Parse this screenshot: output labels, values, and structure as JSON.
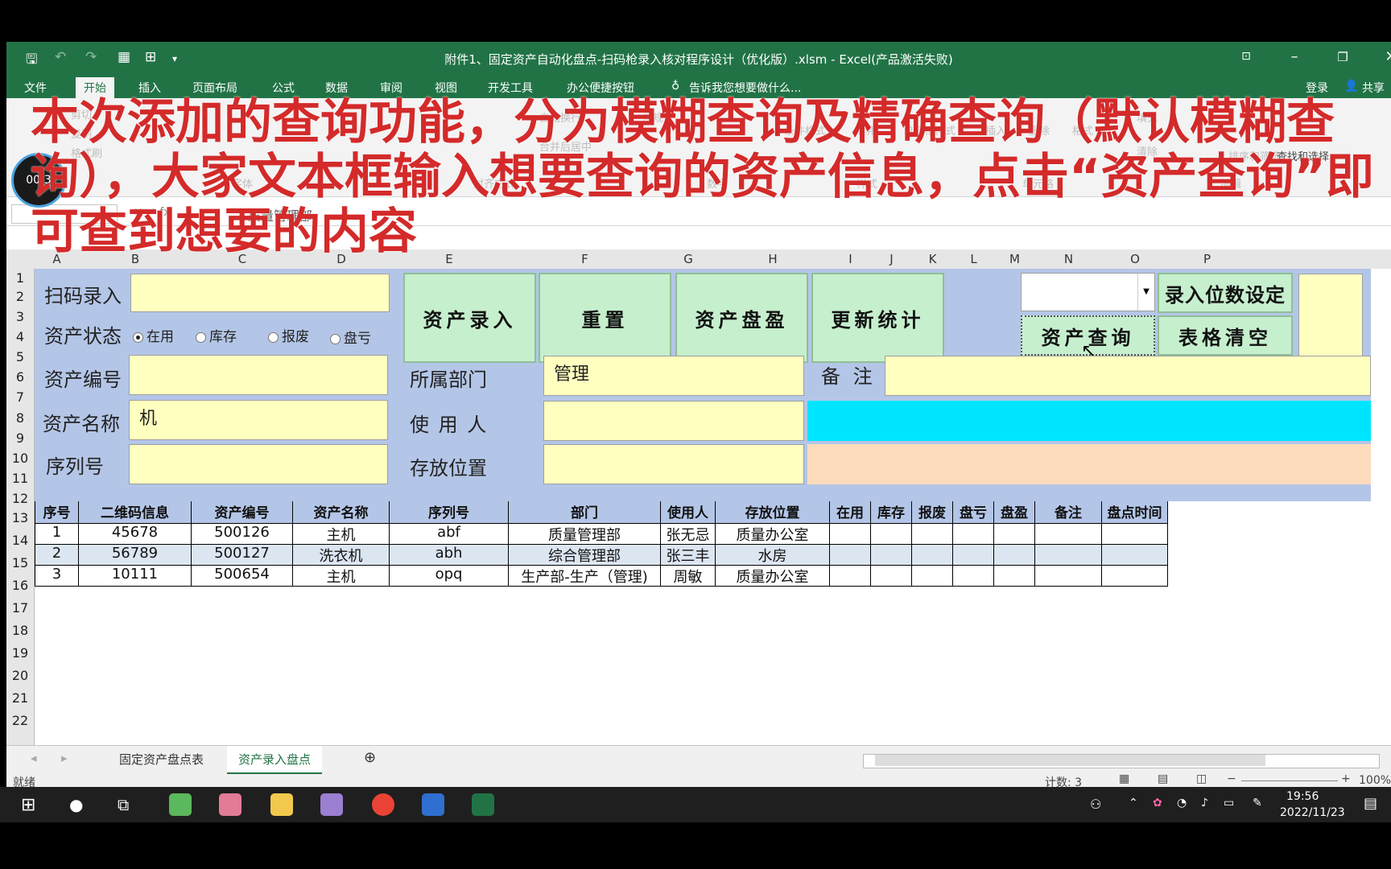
{
  "window": {
    "title": "附件1、固定资产自动化盘点-扫码枪录入核对程序设计（优化版）.xlsm - Excel(产品激活失败)"
  },
  "ribbon": {
    "tabs": [
      "文件",
      "开始",
      "插入",
      "页面布局",
      "公式",
      "数据",
      "审阅",
      "视图",
      "开发工具",
      "办公便捷按钮"
    ],
    "active_tab": "开始",
    "tellme": "告诉我您想要做什么...",
    "login": "登录",
    "share": "共享",
    "groups": [
      "字体",
      "对齐方式",
      "数字",
      "样式",
      "单元格",
      "编辑"
    ],
    "buttons": [
      "剪切",
      "复制",
      "格式刷",
      "自动换行",
      "合并后居中",
      "常规",
      "条件格式",
      "套用",
      "单元格样式",
      "插入",
      "删除",
      "格式",
      "填充",
      "清除",
      "排序和筛选",
      "查找和选择"
    ]
  },
  "overlay_caption": "本次添加的查询功能，分为模糊查询及精确查询（默认模糊查询），大家文本框输入想要查询的资产信息，点击“资产查询”即可查到想要的内容",
  "timer": "00:3",
  "formula_bar": {
    "namebox": "",
    "content": "质量管理部"
  },
  "columns": [
    "A",
    "B",
    "C",
    "D",
    "E",
    "F",
    "G",
    "H",
    "I",
    "J",
    "K",
    "L",
    "M",
    "N",
    "O",
    "P"
  ],
  "rows": [
    "1",
    "2",
    "3",
    "4",
    "5",
    "6",
    "7",
    "8",
    "9",
    "10",
    "11",
    "12",
    "13",
    "14",
    "15",
    "16",
    "17",
    "18",
    "19",
    "20",
    "21",
    "22"
  ],
  "form": {
    "scan_label": "扫码录入",
    "status_label": "资产状态",
    "status_options": [
      "在用",
      "库存",
      "报废",
      "盘亏"
    ],
    "status_selected": "在用",
    "asset_no_label": "资产编号",
    "asset_name_label": "资产名称",
    "asset_name_value": "机",
    "serial_label": "序列号",
    "dept_label": "所属部门",
    "dept_value": "管理",
    "user_label": "使 用 人",
    "location_label": "存放位置",
    "note_label": "备 注",
    "btn_entry": "资产录入",
    "btn_reset": "重置",
    "btn_surplus": "资产盘盈",
    "btn_update": "更新统计",
    "btn_digits": "录入位数设定",
    "btn_query": "资产查询",
    "btn_clear": "表格清空"
  },
  "table": {
    "headers": [
      "序号",
      "二维码信息",
      "资产编号",
      "资产名称",
      "序列号",
      "部门",
      "使用人",
      "存放位置",
      "在用",
      "库存",
      "报废",
      "盘亏",
      "盘盈",
      "备注",
      "盘点时间"
    ],
    "rows": [
      [
        "1",
        "45678",
        "500126",
        "主机",
        "abf",
        "质量管理部",
        "张无忌",
        "质量办公室",
        "",
        "",
        "",
        "",
        "",
        "",
        ""
      ],
      [
        "2",
        "56789",
        "500127",
        "洗衣机",
        "abh",
        "综合管理部",
        "张三丰",
        "水房",
        "",
        "",
        "",
        "",
        "",
        "",
        ""
      ],
      [
        "3",
        "10111",
        "500654",
        "主机",
        "opq",
        "生产部-生产（管理)",
        "周敏",
        "质量办公室",
        "",
        "",
        "",
        "",
        "",
        "",
        ""
      ]
    ]
  },
  "sheets": [
    "固定资产盘点表",
    "资产录入盘点"
  ],
  "active_sheet": "资产录入盘点",
  "status": {
    "ready": "就绪",
    "count": "计数: 3",
    "zoom": "100%"
  },
  "taskbar": {
    "time": "19:56",
    "date": "2022/11/23"
  },
  "colors": {
    "excel_green": "#217346",
    "form_bg": "#b4c6e7",
    "input_yellow": "#ffffc0",
    "button_green": "#c6efce",
    "cyan_bar": "#00e5ff",
    "peach_bar": "#fcdcbc",
    "caption_red": "#d42a2a"
  }
}
